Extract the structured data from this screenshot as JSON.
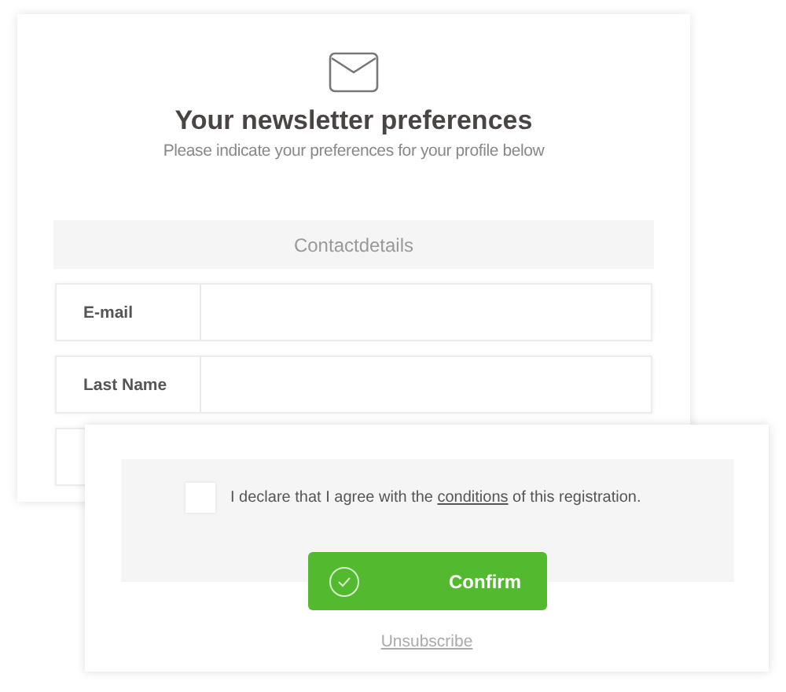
{
  "header": {
    "title": "Your newsletter preferences",
    "subtitle": "Please indicate your preferences for your profile below"
  },
  "section": {
    "title": "Contactdetails"
  },
  "fields": [
    {
      "label": "E-mail"
    },
    {
      "label": "Last Name"
    }
  ],
  "agreement": {
    "checked": false,
    "text_before": "I declare that I agree with the",
    "link": "conditions",
    "text_after": "of this registration."
  },
  "confirm_button": {
    "label": "Confirm"
  },
  "unsubscribe_link": {
    "label": "Unsubscribe"
  }
}
